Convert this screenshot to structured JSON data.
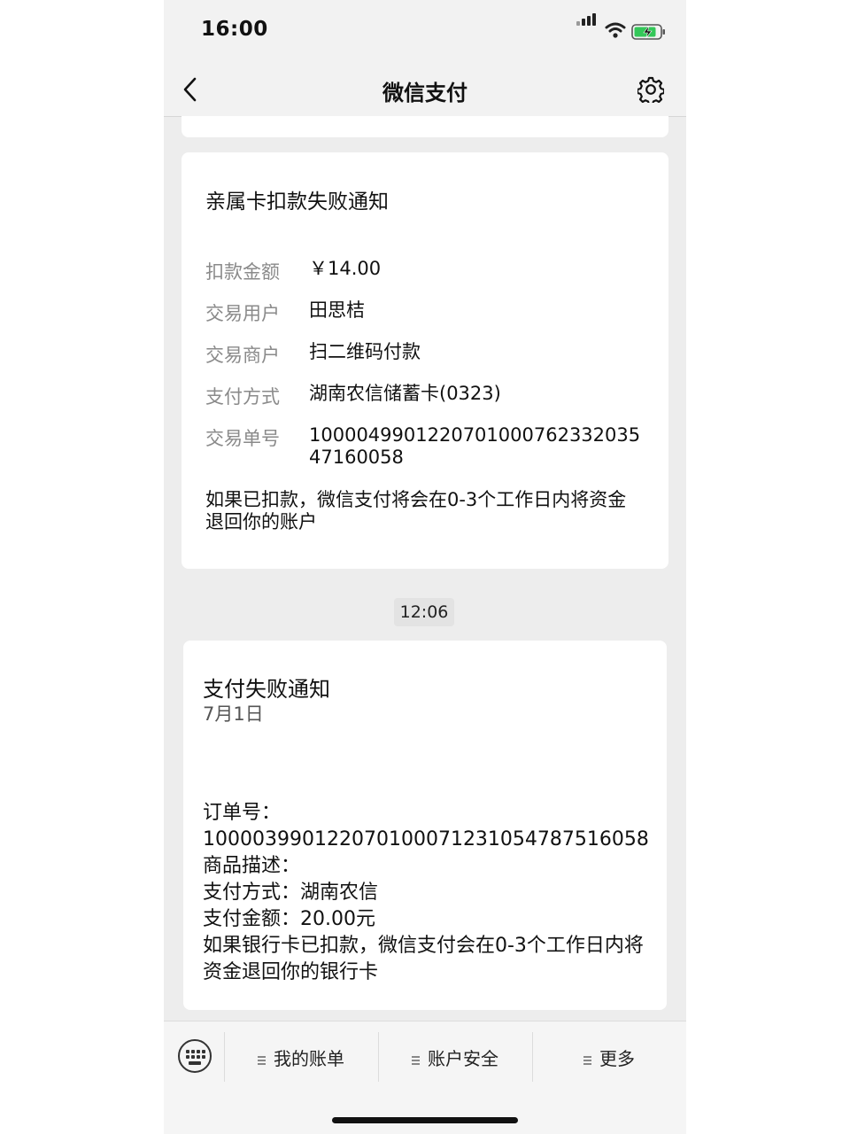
{
  "status_bar": {
    "time": "16:00"
  },
  "nav": {
    "title": "微信支付",
    "back_icon": "chevron-left-icon",
    "settings_icon": "gear-icon"
  },
  "card1": {
    "title": "亲属卡扣款失败通知",
    "rows": [
      {
        "label": "扣款金额",
        "value": "￥14.00"
      },
      {
        "label": "交易用户",
        "value": "田思桔"
      },
      {
        "label": "交易商户",
        "value": "扫二维码付款"
      },
      {
        "label": "支付方式",
        "value": "湖南农信储蓄卡(0323)"
      },
      {
        "label": "交易单号",
        "value": "100004990122070100076233203547160058"
      }
    ],
    "note": "如果已扣款，微信支付将会在0-3个工作日内将资金退回你的账户"
  },
  "timestamp": "12:06",
  "card2": {
    "title": "支付失败通知",
    "date": "7月1日",
    "lines": [
      "订单号：",
      "100003990122070100071231054787516058",
      "商品描述：",
      "支付方式：湖南农信",
      "支付金额：20.00元"
    ],
    "note": "如果银行卡已扣款，微信支付会在0-3个工作日内将资金退回你的银行卡"
  },
  "tabbar": {
    "keyboard_icon": "keyboard-icon",
    "tabs": [
      {
        "label": "我的账单"
      },
      {
        "label": "账户安全"
      },
      {
        "label": "更多"
      }
    ]
  }
}
